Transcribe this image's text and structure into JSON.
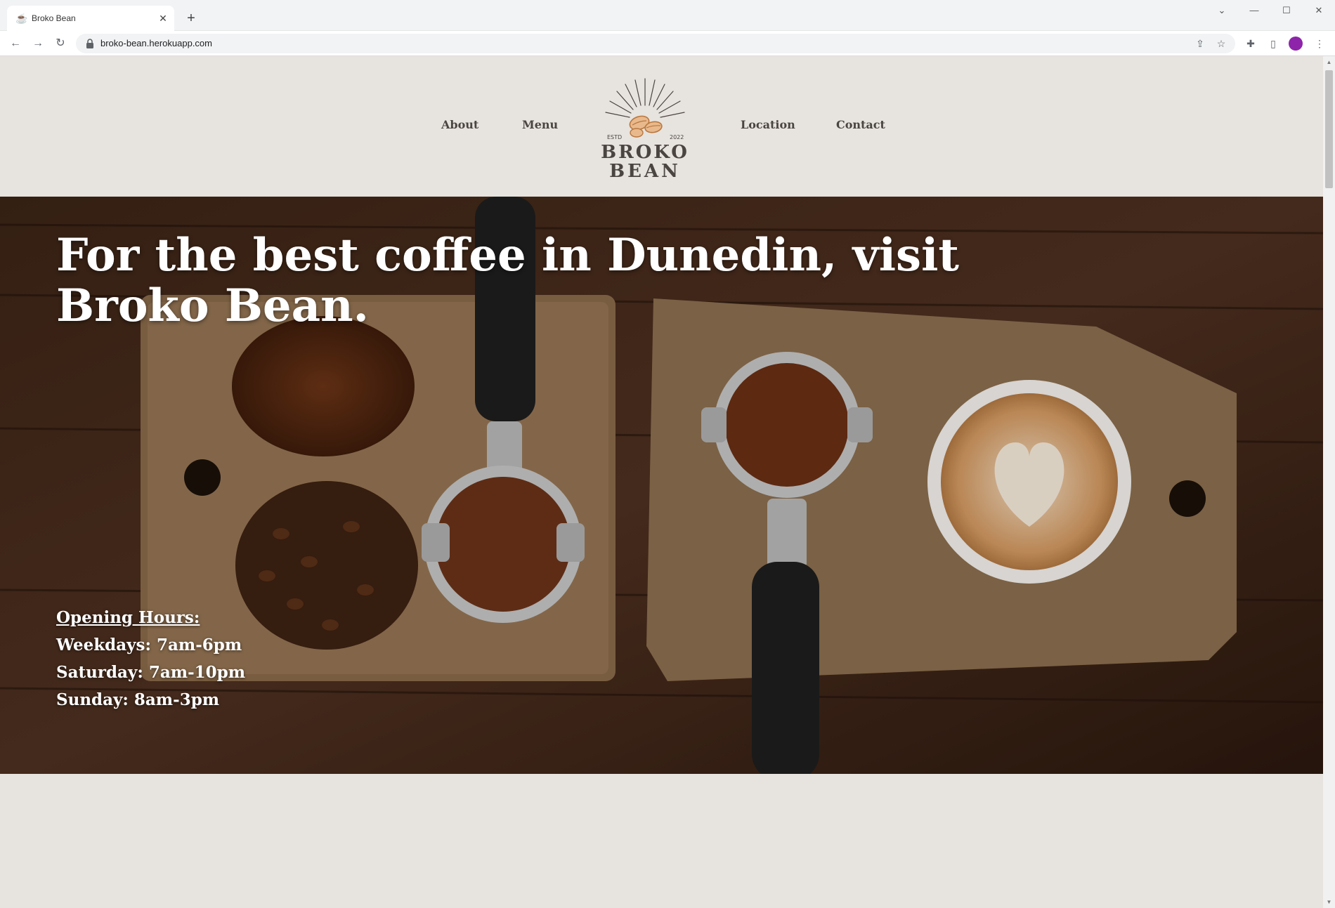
{
  "browser": {
    "tab_title": "Broko Bean",
    "url": "broko-bean.herokuapp.com"
  },
  "site": {
    "logo_text": [
      "BROKO",
      "BEAN"
    ],
    "logo_estd": "ESTD",
    "logo_year": "2022",
    "nav": {
      "about": "About",
      "menu": "Menu",
      "location": "Location",
      "contact": "Contact"
    }
  },
  "hero": {
    "title": "For the best coffee in Dunedin, visit Broko Bean.",
    "hours_heading": "Opening Hours:",
    "hours": [
      "Weekdays: 7am-6pm",
      "Saturday: 7am-10pm",
      "Sunday: 8am-3pm"
    ]
  },
  "colors": {
    "page_background": "#e7e3de",
    "nav_text": "#4b4541",
    "hero_text": "#ffffff"
  },
  "icons": [
    "coffee-favicon-icon",
    "close-icon",
    "plus-icon",
    "back-arrow-icon",
    "forward-arrow-icon",
    "reload-icon",
    "lock-icon",
    "share-icon",
    "star-icon",
    "extensions-icon",
    "side-panel-icon",
    "profile-avatar-icon",
    "more-vertical-icon",
    "minimize-icon",
    "maximize-icon",
    "window-close-icon",
    "chevron-down-icon"
  ]
}
